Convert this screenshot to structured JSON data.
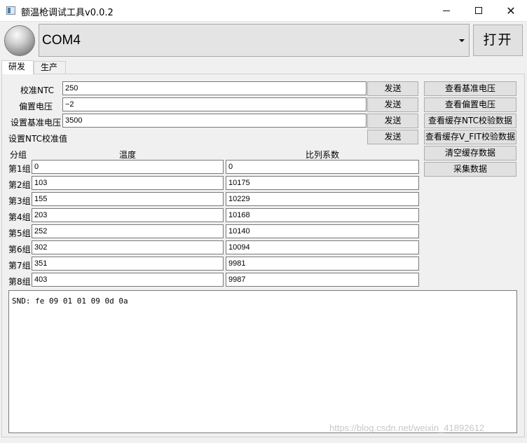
{
  "window": {
    "title": "额温枪调试工具v0.0.2",
    "minimize_label": "minimize",
    "maximize_label": "maximize",
    "close_label": "close"
  },
  "toolbar": {
    "port_selected": "COM4",
    "open_label": "打开"
  },
  "tabs": [
    {
      "label": "研发",
      "active": true
    },
    {
      "label": "生产",
      "active": false
    }
  ],
  "settings": [
    {
      "label": "校准NTC",
      "value": "250",
      "send_label": "发送"
    },
    {
      "label": "偏置电压",
      "value": "−2",
      "send_label": "发送"
    },
    {
      "label": "设置基准电压",
      "value": "3500",
      "send_label": "发送"
    },
    {
      "label": "设置NTC校准值",
      "value": "",
      "send_label": "发送"
    }
  ],
  "side_buttons": [
    "查看基准电压",
    "查看偏置电压",
    "查看缓存NTC校验数据",
    "查看缓存V_FIT校验数据",
    "清空缓存数据",
    "采集数据"
  ],
  "table": {
    "headers": {
      "group": "分组",
      "temperature": "温度",
      "ratio": "比列系数"
    },
    "rows": [
      {
        "group": "第1组",
        "temperature": "0",
        "ratio": "0"
      },
      {
        "group": "第2组",
        "temperature": "103",
        "ratio": "10175"
      },
      {
        "group": "第3组",
        "temperature": "155",
        "ratio": "10229"
      },
      {
        "group": "第4组",
        "temperature": "203",
        "ratio": "10168"
      },
      {
        "group": "第5组",
        "temperature": "252",
        "ratio": "10140"
      },
      {
        "group": "第6组",
        "temperature": "302",
        "ratio": "10094"
      },
      {
        "group": "第7组",
        "temperature": "351",
        "ratio": "9981"
      },
      {
        "group": "第8组",
        "temperature": "403",
        "ratio": "9987"
      }
    ]
  },
  "log": {
    "text": "SND: fe 09 01 01 09 0d 0a"
  },
  "watermark": "https://blog.csdn.net/weixin_41892612",
  "icons": {
    "app": "app-window-icon",
    "status": "connection-status-led-icon",
    "dropdown": "chevron-down-icon"
  }
}
